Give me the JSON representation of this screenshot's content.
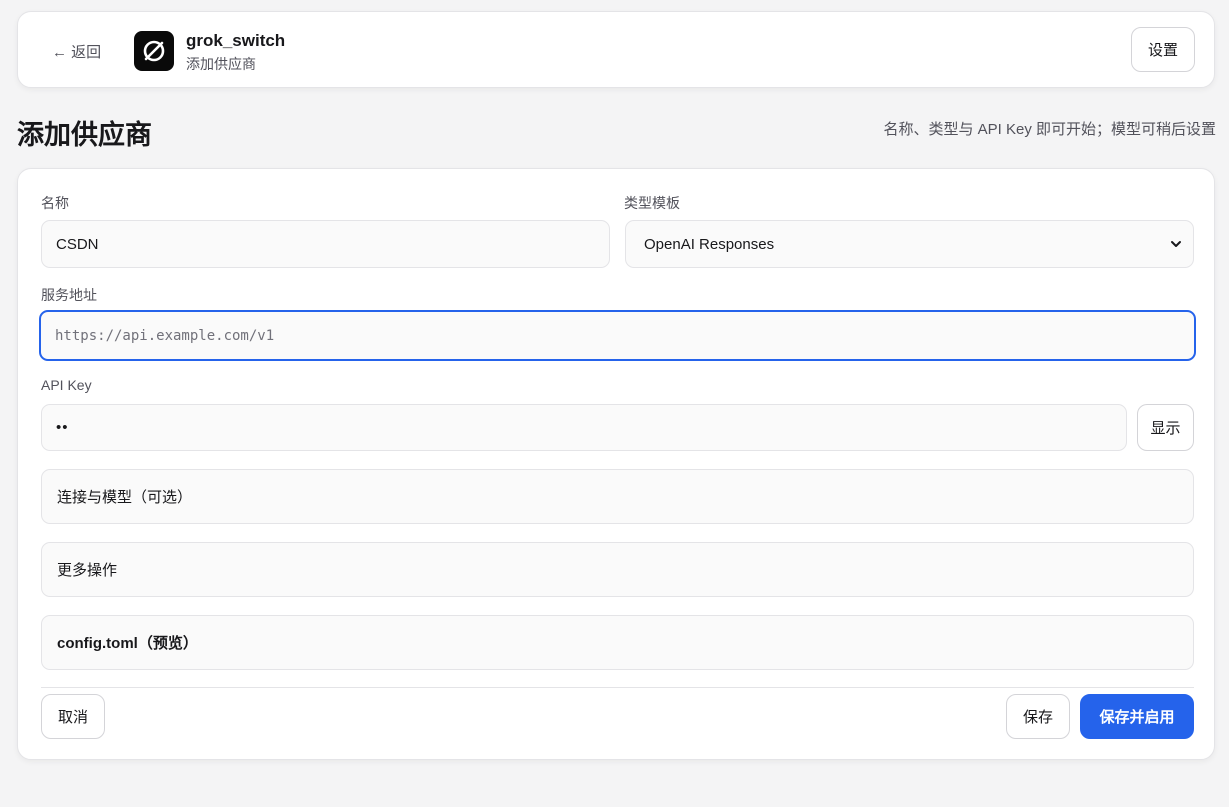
{
  "header": {
    "back_label": "← 返回",
    "app_name": "grok_switch",
    "app_subtitle": "添加供应商",
    "settings_label": "设置"
  },
  "page": {
    "title": "添加供应商",
    "hint": "名称、类型与 API Key 即可开始；模型可稍后设置"
  },
  "form": {
    "name_label": "名称",
    "name_value": "CSDN",
    "type_label": "类型模板",
    "type_value": "OpenAI Responses",
    "url_label": "服务地址",
    "url_placeholder": "https://api.example.com/v1",
    "url_value": "",
    "apikey_label": "API Key",
    "apikey_value": "••",
    "show_label": "显示"
  },
  "sections": {
    "connection": "连接与模型（可选）",
    "more": "更多操作",
    "config_preview": "config.toml（预览）"
  },
  "footer": {
    "cancel_label": "取消",
    "save_label": "保存",
    "save_enable_label": "保存并启用"
  },
  "colors": {
    "accent": "#2563eb",
    "background": "#f4f4f5",
    "logo_bg": "#0a0a0a"
  }
}
